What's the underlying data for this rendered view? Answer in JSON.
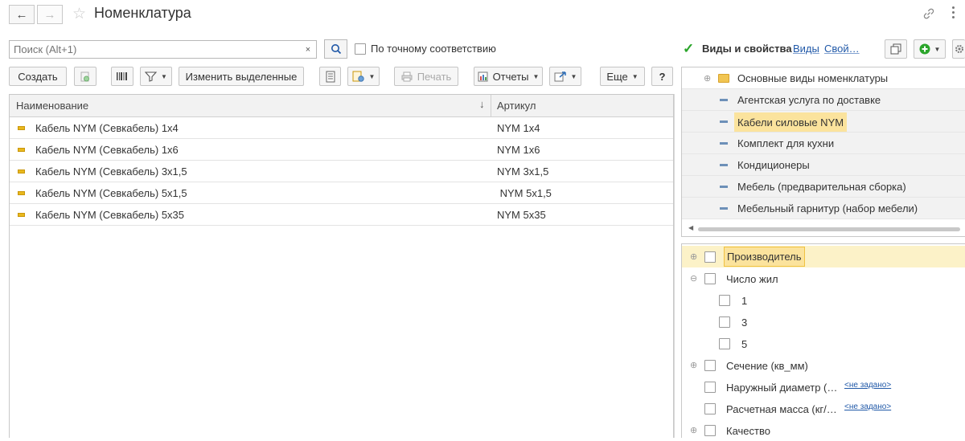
{
  "window": {
    "title": "Номенклатура",
    "back_icon": "arrow-left-icon",
    "forward_icon": "arrow-right-icon"
  },
  "search": {
    "placeholder": "Поиск (Alt+1)",
    "clear_label": "×",
    "exact_match_label": "По точному соответствию"
  },
  "toolbar": {
    "create_label": "Создать",
    "change_selected_label": "Изменить выделенные",
    "print_label": "Печать",
    "reports_label": "Отчеты",
    "more_label": "Еще",
    "help_label": "?"
  },
  "table": {
    "columns": [
      "Наименование",
      "Артикул"
    ],
    "sort_indicator": "↓",
    "rows": [
      {
        "name": "Кабель NYM (Севкабель) 1x4",
        "article": "NYM 1x4"
      },
      {
        "name": "Кабель NYM (Севкабель) 1x6",
        "article": "NYM 1x6"
      },
      {
        "name": "Кабель NYM (Севкабель) 3x1,5",
        "article": "NYM 3x1,5"
      },
      {
        "name": "Кабель NYM (Севкабель) 5x1,5",
        "article": " NYM 5x1,5"
      },
      {
        "name": "Кабель NYM (Севкабель) 5x35",
        "article": "NYM 5x35"
      }
    ]
  },
  "right_panel": {
    "title": "Виды и свойства",
    "link_kinds": "Виды",
    "link_props": "Свой…",
    "kinds": [
      {
        "label": "Основные виды номенклатуры",
        "folder": true
      },
      {
        "label": "Агентская услуга по доставке"
      },
      {
        "label": "Кабели силовые NYM",
        "selected": true
      },
      {
        "label": "Комплект для кухни"
      },
      {
        "label": "Кондиционеры"
      },
      {
        "label": "Мебель (предварительная сборка)"
      },
      {
        "label": "Мебельный гарнитур (набор мебели)"
      }
    ],
    "properties": [
      {
        "label": "Производитель",
        "expand": "⊕",
        "selected": true
      },
      {
        "label": "Число жил",
        "expand": "⊖"
      },
      {
        "label": "1",
        "child": true
      },
      {
        "label": "3",
        "child": true
      },
      {
        "label": "5",
        "child": true
      },
      {
        "label": "Сечение (кв_мм)",
        "expand": "⊕"
      },
      {
        "label": "Наружный диаметр (…",
        "value": "<не задано>"
      },
      {
        "label": "Расчетная масса (кг/…",
        "value": "<не задано>"
      },
      {
        "label": "Качество",
        "expand": "⊕"
      }
    ]
  },
  "colors": {
    "accent_green": "#2aa52a",
    "selection_yellow": "#fbe39d",
    "link_blue": "#2159a8"
  }
}
